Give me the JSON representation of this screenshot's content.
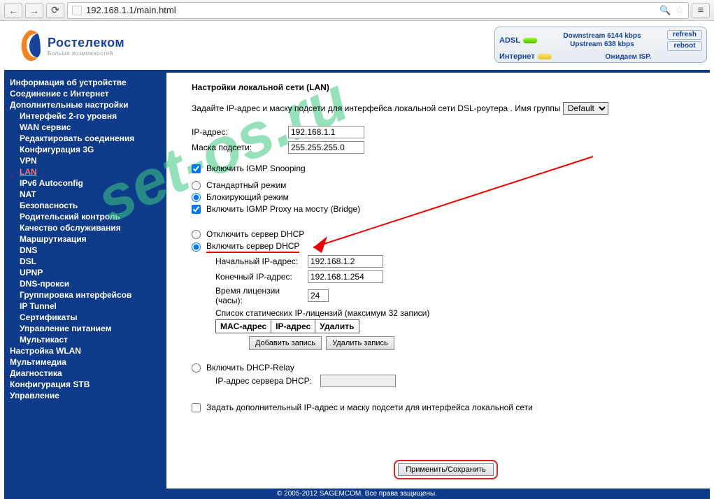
{
  "browser": {
    "url": "192.168.1.1/main.html"
  },
  "logo": {
    "name": "Ростелеком",
    "tagline": "Больше возможностей"
  },
  "status": {
    "adsl_label": "ADSL",
    "downstream": "Downstream 6144 kbps",
    "upstream": "Upstream    638 kbps",
    "refresh": "refresh",
    "reboot": "reboot",
    "internet_label": "Интернет",
    "waiting": "Ожидаем ISP."
  },
  "nav": {
    "items": [
      {
        "label": "Информация об устройстве",
        "sub": false
      },
      {
        "label": "Соединение с Интернет",
        "sub": false
      },
      {
        "label": "Дополнительные настройки",
        "sub": false
      },
      {
        "label": "Интерфейс 2-го уровня",
        "sub": true
      },
      {
        "label": "WAN сервис",
        "sub": true
      },
      {
        "label": "Редактировать соединения",
        "sub": true
      },
      {
        "label": "Конфигурация 3G",
        "sub": true
      },
      {
        "label": "VPN",
        "sub": true
      },
      {
        "label": "LAN",
        "sub": true,
        "current": true
      },
      {
        "label": "IPv6 Autoconfig",
        "sub": true
      },
      {
        "label": "NAT",
        "sub": true
      },
      {
        "label": "Безопасность",
        "sub": true
      },
      {
        "label": "Родительский контроль",
        "sub": true
      },
      {
        "label": "Качество обслуживания",
        "sub": true
      },
      {
        "label": "Маршрутизация",
        "sub": true
      },
      {
        "label": "DNS",
        "sub": true
      },
      {
        "label": "DSL",
        "sub": true
      },
      {
        "label": "UPNP",
        "sub": true
      },
      {
        "label": "DNS-прокси",
        "sub": true
      },
      {
        "label": "Группировка интерфейсов",
        "sub": true
      },
      {
        "label": "IP Tunnel",
        "sub": true
      },
      {
        "label": "Сертификаты",
        "sub": true
      },
      {
        "label": "Управление питанием",
        "sub": true
      },
      {
        "label": "Мультикаст",
        "sub": true
      },
      {
        "label": "Настройка WLAN",
        "sub": false
      },
      {
        "label": "Мультимедиа",
        "sub": false
      },
      {
        "label": "Диагностика",
        "sub": false
      },
      {
        "label": "Конфигурация STB",
        "sub": false
      },
      {
        "label": "Управление",
        "sub": false
      }
    ]
  },
  "page": {
    "title": "Настройки локальной сети (LAN)",
    "desc_a": "Задайте IP-адрес и маску подсети для интерфейса локальной сети DSL-роутера .  Имя группы",
    "group_value": "Default",
    "ip_label": "IP-адрес:",
    "ip_value": "192.168.1.1",
    "mask_label": "Маска подсети:",
    "mask_value": "255.255.255.0",
    "igmp_snoop": "Включить IGMP Snooping",
    "mode_std": "Стандартный режим",
    "mode_block": "Блокирующий режим",
    "igmp_bridge": "Включить IGMP Proxy на мосту (Bridge)",
    "dhcp_off": "Отключить сервер DHCP",
    "dhcp_on": "Включить сервер DHCP",
    "start_ip_label": "Начальный IP-адрес:",
    "start_ip_value": "192.168.1.2",
    "end_ip_label": "Конечный IP-адрес:",
    "end_ip_value": "192.168.1.254",
    "lease_label": "Время лицензии (часы):",
    "lease_value": "24",
    "static_caption": "Список статических IP-лицензий (максимум 32 записи)",
    "th_mac": "MAC-адрес",
    "th_ip": "IP-адрес",
    "th_del": "Удалить",
    "btn_add": "Добавить запись",
    "btn_remove": "Удалить запись",
    "dhcp_relay": "Включить DHCP-Relay",
    "relay_ip_label": "IP-адрес сервера DHCP:",
    "relay_ip_value": "",
    "extra_ip": "Задать дополнительный IP-адрес и маску подсети для интерфейса локальной сети",
    "apply": "Применить/Сохранить"
  },
  "footer": "© 2005-2012 SAGEMCOM. Все права защищены.",
  "watermark": "set-os.ru"
}
